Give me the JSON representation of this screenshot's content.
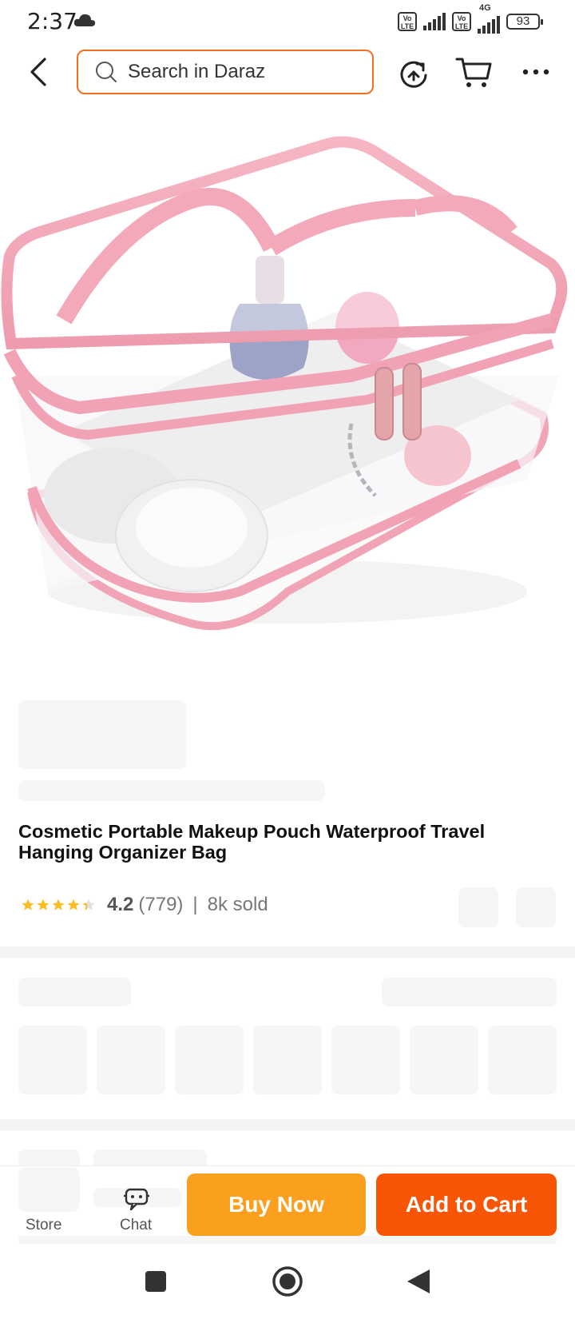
{
  "status_bar": {
    "time": "2:37",
    "network": "4G",
    "battery": "93",
    "volte_label": "Vo LTE"
  },
  "header": {
    "search_placeholder": "Search in Daraz"
  },
  "product": {
    "title": "Cosmetic Portable Makeup Pouch Waterproof Travel Hanging Organizer Bag",
    "rating": "4.2",
    "review_count": "(779)",
    "separator": "|",
    "sold": "8k sold",
    "stars_filled": 4.2
  },
  "bottom_bar": {
    "store_label": "Store",
    "chat_label": "Chat",
    "buy_now_label": "Buy Now",
    "add_to_cart_label": "Add to Cart"
  },
  "colors": {
    "accent": "#f36f21",
    "buy_now": "#fba01e",
    "add_to_cart": "#f85606",
    "star": "#fbbd24"
  },
  "icons": [
    "back-arrow-icon",
    "search-icon",
    "share-icon",
    "cart-icon",
    "more-icon",
    "store-icon",
    "chat-icon"
  ]
}
